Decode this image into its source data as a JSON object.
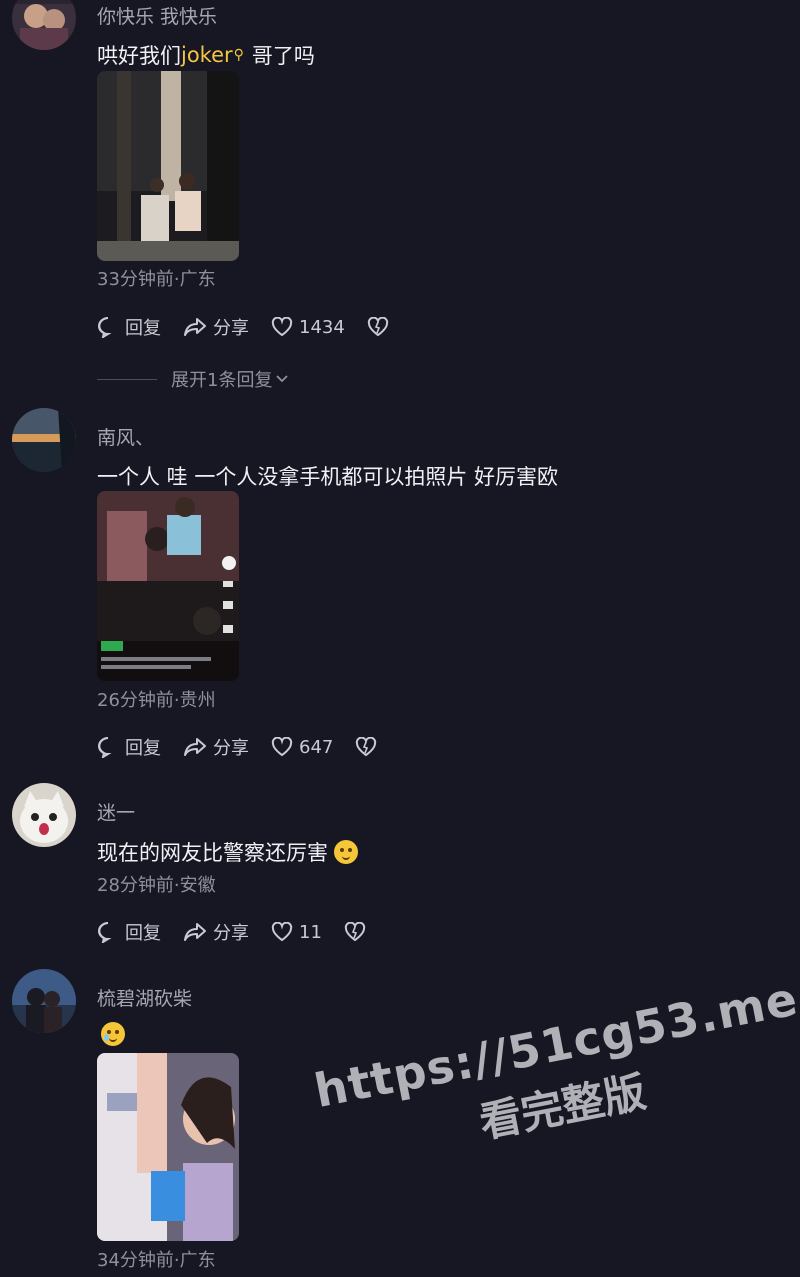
{
  "comments": [
    {
      "username": "你快乐 我快乐",
      "text_before": "哄好我们",
      "mention": "joker",
      "text_after": "哥了吗",
      "meta": "33分钟前·广东",
      "reply_label": "回复",
      "share_label": "分享",
      "likes": "1434",
      "expand_label": "展开1条回复"
    },
    {
      "username": "南风、",
      "text": "一个人 哇 一个人没拿手机都可以拍照片 好厉害欧",
      "meta": "26分钟前·贵州",
      "reply_label": "回复",
      "share_label": "分享",
      "likes": "647"
    },
    {
      "username": "迷一",
      "text": "现在的网友比警察还厉害",
      "meta": "28分钟前·安徽",
      "reply_label": "回复",
      "share_label": "分享",
      "likes": "11"
    },
    {
      "username": "梳碧湖砍柴",
      "meta": "34分钟前·广东"
    }
  ],
  "watermark": {
    "url": "https://51cg53.me",
    "sub": "看完整版"
  },
  "icons": {
    "reply": "comment-bubble-icon",
    "share": "share-arrow-icon",
    "like": "heart-icon",
    "dislike": "broken-heart-icon",
    "expand": "chevron-down-icon",
    "mention": "search-icon"
  },
  "colors": {
    "background": "#161722",
    "mention": "#f5c542",
    "meta": "#8e909c"
  }
}
